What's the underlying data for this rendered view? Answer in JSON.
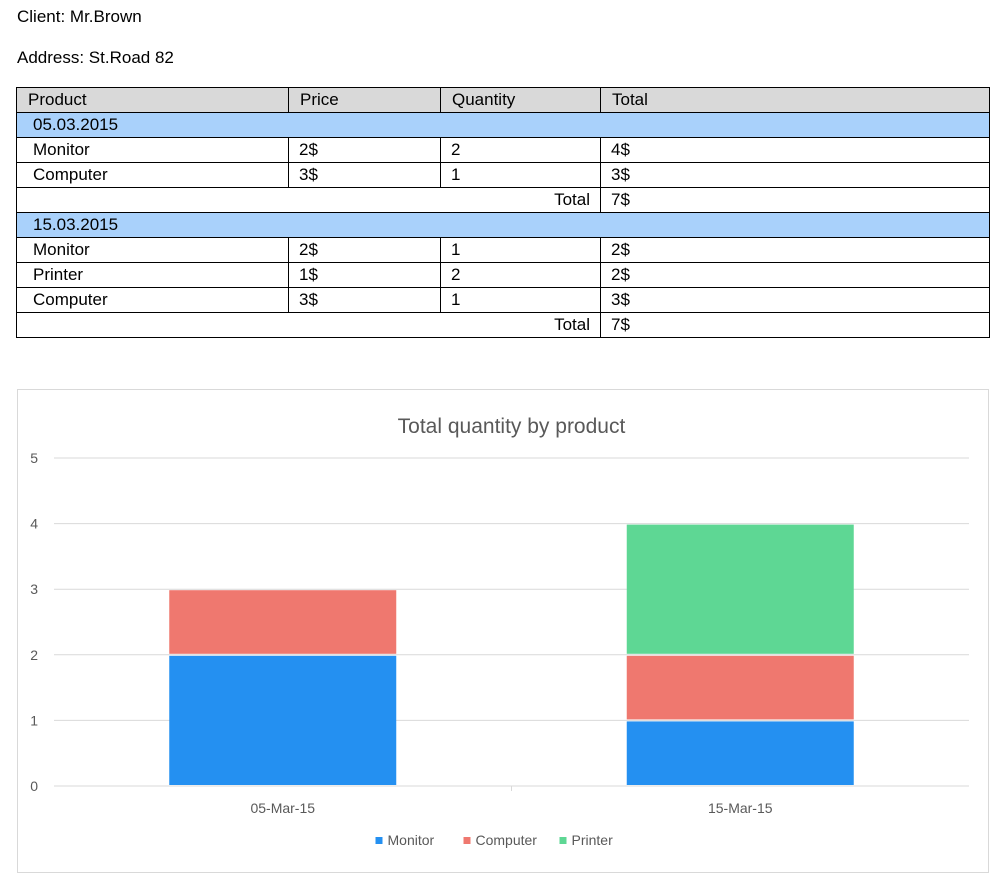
{
  "client_line": "Client: Mr.Brown",
  "address_line": "Address: St.Road 82",
  "table": {
    "headers": [
      "Product",
      "Price",
      "Quantity",
      "Total"
    ],
    "groups": [
      {
        "date": "05.03.2015",
        "rows": [
          {
            "product": "Monitor",
            "price": "2$",
            "quantity": "2",
            "total": "4$"
          },
          {
            "product": "Computer",
            "price": "3$",
            "quantity": "1",
            "total": "3$"
          }
        ],
        "subtotal_label": "Total",
        "subtotal_value": "7$"
      },
      {
        "date": "15.03.2015",
        "rows": [
          {
            "product": "Monitor",
            "price": "2$",
            "quantity": "1",
            "total": "2$"
          },
          {
            "product": "Printer",
            "price": "1$",
            "quantity": "2",
            "total": "2$"
          },
          {
            "product": "Computer",
            "price": "3$",
            "quantity": "1",
            "total": "3$"
          }
        ],
        "subtotal_label": "Total",
        "subtotal_value": "7$"
      }
    ]
  },
  "chart_data": {
    "type": "bar",
    "stacked": true,
    "title": "Total quantity by product",
    "xlabel": "",
    "ylabel": "",
    "categories": [
      "05-Mar-15",
      "15-Mar-15"
    ],
    "series": [
      {
        "name": "Monitor",
        "values": [
          2,
          1
        ],
        "color": "#2490f1"
      },
      {
        "name": "Computer",
        "values": [
          1,
          1
        ],
        "color": "#ef786f"
      },
      {
        "name": "Printer",
        "values": [
          0,
          2
        ],
        "color": "#5ed794"
      }
    ],
    "ylim": [
      0,
      5
    ],
    "yticks": [
      0,
      1,
      2,
      3,
      4,
      5
    ],
    "grid": true,
    "legend_position": "bottom"
  }
}
